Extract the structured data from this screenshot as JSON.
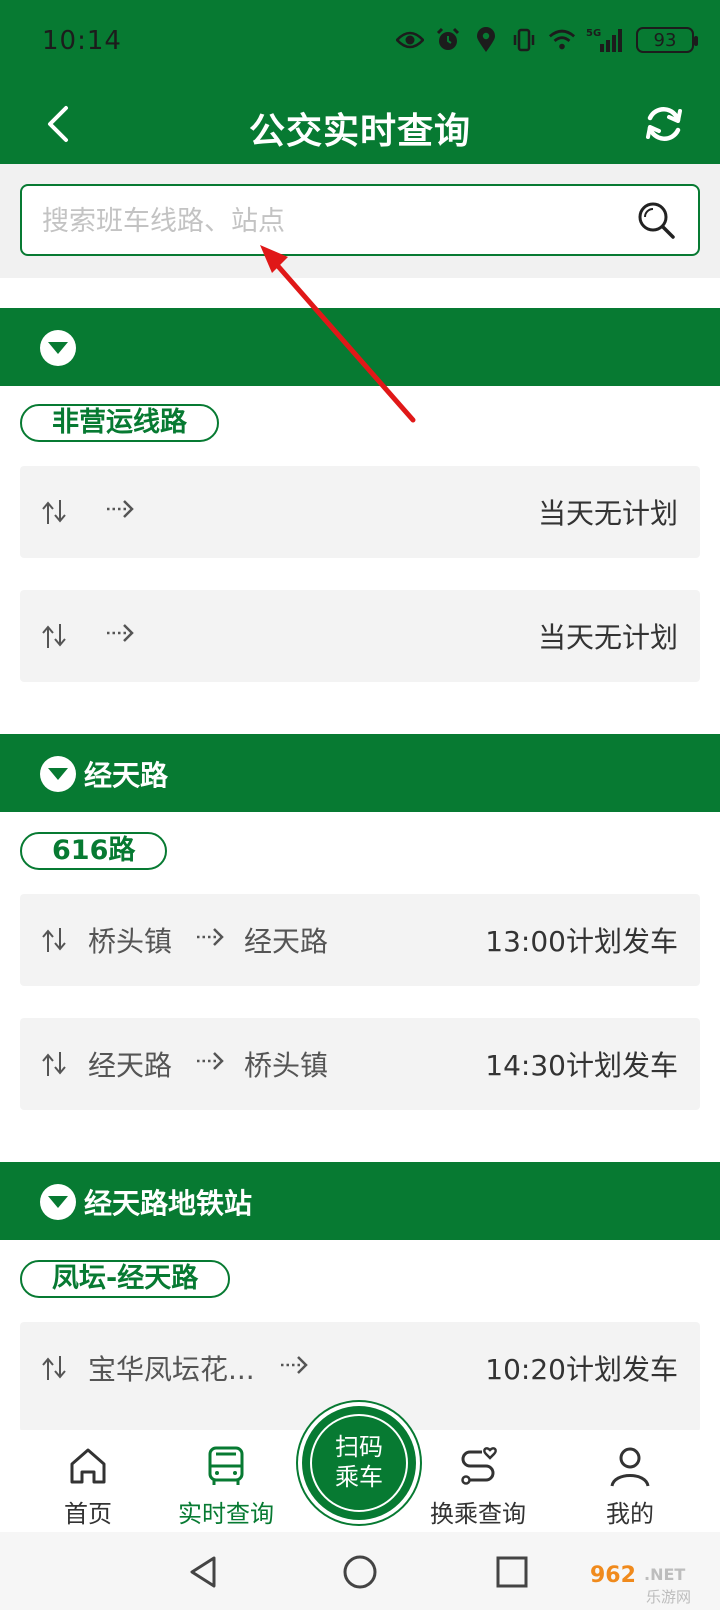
{
  "status_bar": {
    "time": "10:14",
    "network": "5G",
    "battery": "93"
  },
  "header": {
    "title": "公交实时查询"
  },
  "search": {
    "placeholder": "搜索班车线路、站点"
  },
  "groups": [
    {
      "name": "",
      "line": "非营运线路",
      "rows": [
        {
          "from": "",
          "to": "",
          "status": "当天无计划"
        },
        {
          "from": "",
          "to": "",
          "status": "当天无计划"
        }
      ]
    },
    {
      "name": "经天路",
      "line": "616路",
      "rows": [
        {
          "from": "桥头镇",
          "to": "经天路",
          "status": "13:00计划发车"
        },
        {
          "from": "经天路",
          "to": "桥头镇",
          "status": "14:30计划发车"
        }
      ]
    },
    {
      "name": "经天路地铁站",
      "line": "凤坛-经天路",
      "rows": [
        {
          "from": "宝华凤坛花...",
          "to": "",
          "status": "10:20计划发车"
        }
      ]
    }
  ],
  "tabbar": {
    "home": "首页",
    "realtime": "实时查询",
    "scan_line1": "扫码",
    "scan_line2": "乘车",
    "transfer": "换乘查询",
    "mine": "我的"
  },
  "watermark": {
    "text_top": "962.NET",
    "text_bottom": "乐游网"
  },
  "colors": {
    "brand_green": "#077a32",
    "annotation_red": "#e01818"
  }
}
